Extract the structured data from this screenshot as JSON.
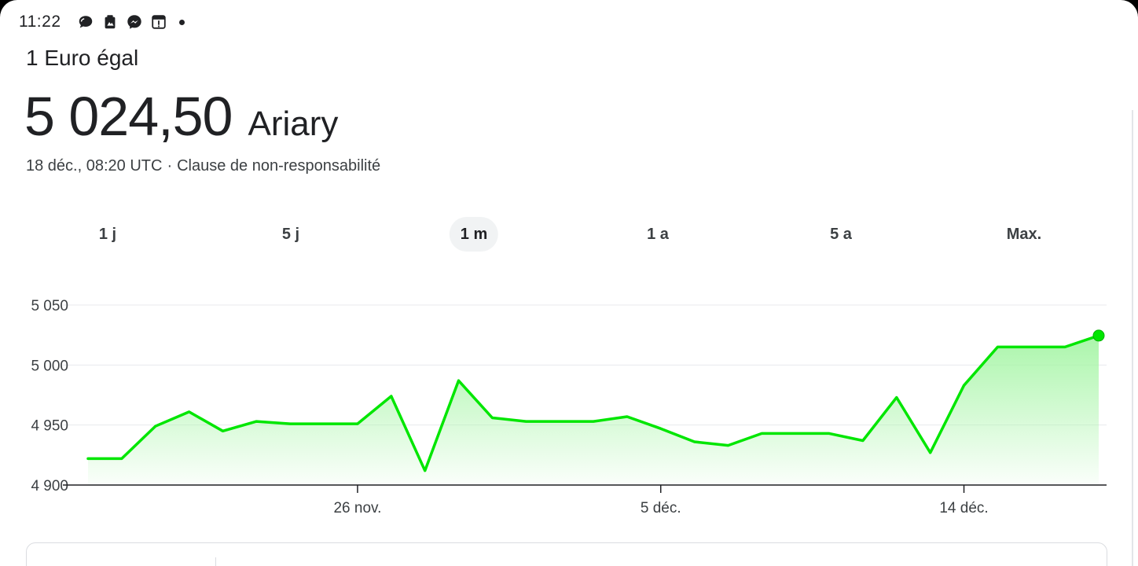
{
  "status": {
    "time": "11:22",
    "icons": [
      "chat-bubble-icon",
      "photo-icon",
      "messenger-icon",
      "alert-box-icon"
    ]
  },
  "header": {
    "label": "1 Euro égal",
    "value": "5 024,50",
    "currency": "Ariary",
    "timestamp": "18 déc., 08:20 UTC",
    "separator": "·",
    "disclaimer": "Clause de non-responsabilité"
  },
  "tabs": [
    {
      "label": "1 j",
      "active": false
    },
    {
      "label": "5 j",
      "active": false
    },
    {
      "label": "1 m",
      "active": true
    },
    {
      "label": "1 a",
      "active": false
    },
    {
      "label": "5 a",
      "active": false
    },
    {
      "label": "Max.",
      "active": false
    }
  ],
  "colors": {
    "line": "#00e600",
    "fill_top": "#a6f5a6",
    "text": "#202124",
    "grid": "#e8eaed"
  },
  "chart_data": {
    "type": "area",
    "title": "",
    "xlabel": "",
    "ylabel": "",
    "x": [
      "2024-11-18",
      "2024-11-19",
      "2024-11-20",
      "2024-11-21",
      "2024-11-22",
      "2024-11-23",
      "2024-11-24",
      "2024-11-25",
      "2024-11-26",
      "2024-11-27",
      "2024-11-28",
      "2024-11-29",
      "2024-11-30",
      "2024-12-01",
      "2024-12-02",
      "2024-12-03",
      "2024-12-04",
      "2024-12-05",
      "2024-12-06",
      "2024-12-07",
      "2024-12-08",
      "2024-12-09",
      "2024-12-10",
      "2024-12-11",
      "2024-12-12",
      "2024-12-13",
      "2024-12-14",
      "2024-12-15",
      "2024-12-16",
      "2024-12-17",
      "2024-12-18"
    ],
    "values": [
      4922,
      4922,
      4949,
      4961,
      4945,
      4953,
      4951,
      4951,
      4951,
      4974,
      4912,
      4987,
      4956,
      4953,
      4953,
      4953,
      4957,
      4947,
      4936,
      4933,
      4943,
      4943,
      4943,
      4937,
      4973,
      4927,
      4983,
      5015,
      5015,
      5015,
      5024.5
    ],
    "x_tick_labels": [
      {
        "date": "2024-11-26",
        "label": "26 nov."
      },
      {
        "date": "2024-12-05",
        "label": "5 déc."
      },
      {
        "date": "2024-12-14",
        "label": "14 déc."
      }
    ],
    "y_ticks": [
      4900,
      4950,
      5000,
      5050
    ],
    "y_tick_labels": [
      "4 900",
      "4 950",
      "5 000",
      "5 050"
    ],
    "ylim": [
      4900,
      5050
    ],
    "grid": true,
    "legend": "none"
  }
}
